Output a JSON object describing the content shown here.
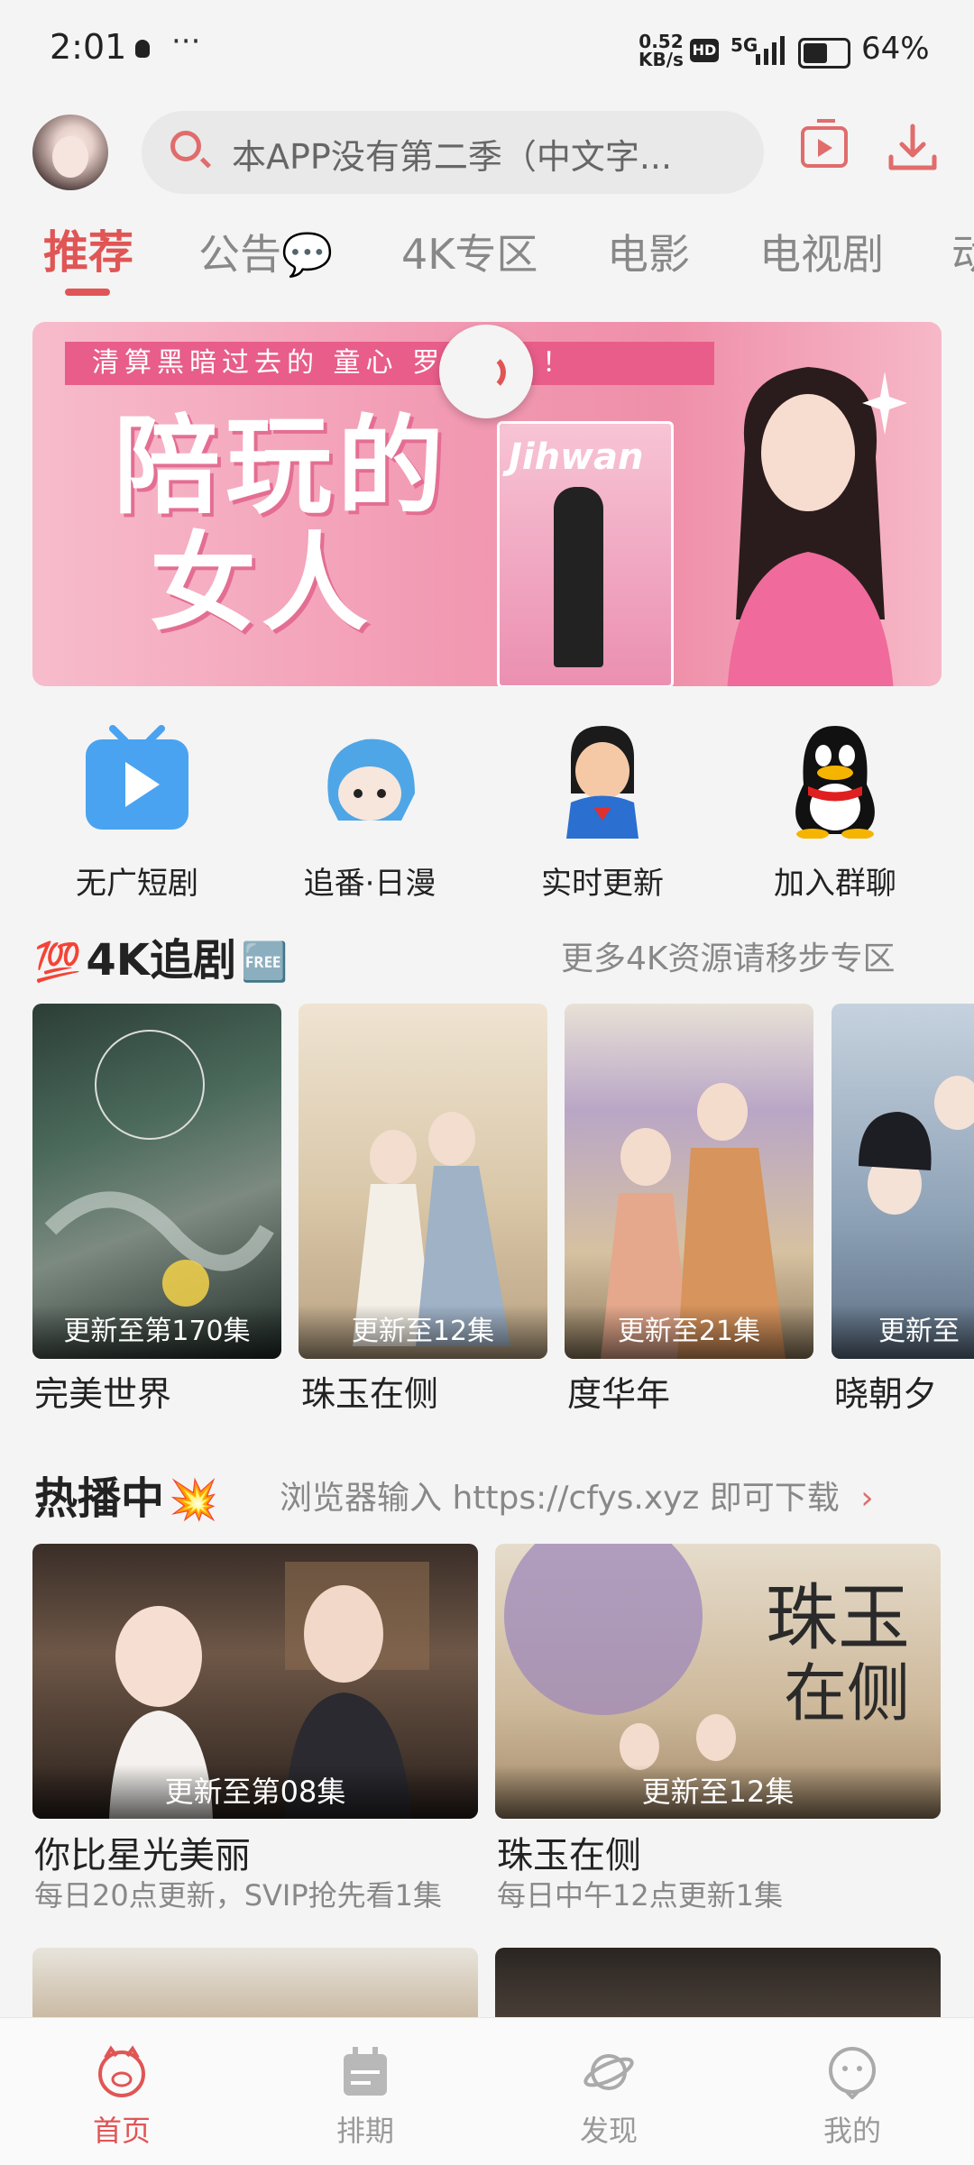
{
  "status_bar": {
    "time": "2:01",
    "dots": "···",
    "net_speed_value": "0.52",
    "net_speed_unit": "KB/s",
    "hd": "HD",
    "signal": "5G",
    "battery": "64%",
    "battery_level": 0.64
  },
  "header": {
    "search_placeholder": "本APP没有第二季（中文字..."
  },
  "tabs": [
    "推荐",
    "公告💬",
    "4K专区",
    "电影",
    "电视剧",
    "动"
  ],
  "banner": {
    "strip_text": "清算黑暗过去的 童心 罗曼史？！",
    "title_line1": "陪玩的",
    "title_line2": "女人",
    "brand": "Jihwan"
  },
  "quick_links": [
    {
      "label": "无广短剧",
      "icon": "tv-play-icon"
    },
    {
      "label": "追番·日漫",
      "icon": "anime-character-icon"
    },
    {
      "label": "实时更新",
      "icon": "superman-icon"
    },
    {
      "label": "加入群聊",
      "icon": "penguin-icon"
    }
  ],
  "section_4k": {
    "emoji_left": "💯",
    "title": "4K追剧",
    "emoji_right": "🆓",
    "right_text": "更多4K资源请移步专区",
    "items": [
      {
        "title": "完美世界",
        "caption": "更新至第170集",
        "color": "#2f4a3f"
      },
      {
        "title": "珠玉在侧",
        "caption": "更新至12集",
        "color": "#c9b79c"
      },
      {
        "title": "度华年",
        "caption": "更新至21集",
        "color": "#d8c2a4"
      },
      {
        "title": "晓朝夕",
        "caption": "更新至",
        "color": "#8ea2b7"
      }
    ]
  },
  "section_hot": {
    "title": "热播中",
    "emoji": "💥",
    "right_text": "浏览器输入 https://cfys.xyz 即可下载",
    "arrow": "›",
    "items": [
      {
        "title": "你比星光美丽",
        "caption": "更新至第08集",
        "sub": "每日20点更新，SVIP抢先看1集",
        "color": "#4a3a30"
      },
      {
        "title": "珠玉在侧",
        "caption": "更新至12集",
        "sub": "每日中午12点更新1集",
        "color": "#cdb89a"
      }
    ]
  },
  "bottom_nav": [
    {
      "label": "首页",
      "icon": "home-pig-icon",
      "active": true
    },
    {
      "label": "排期",
      "icon": "calendar-icon",
      "active": false
    },
    {
      "label": "发现",
      "icon": "planet-icon",
      "active": false
    },
    {
      "label": "我的",
      "icon": "profile-face-icon",
      "active": false
    }
  ]
}
